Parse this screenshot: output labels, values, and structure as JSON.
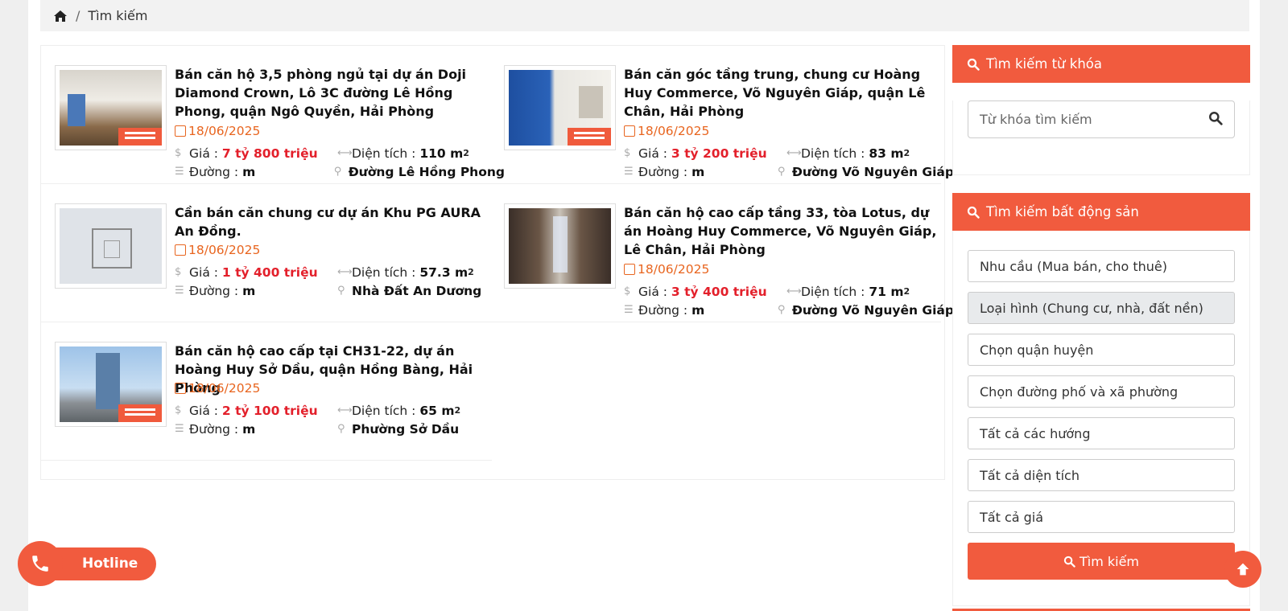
{
  "breadcrumb": {
    "home_icon": "home-icon",
    "current": "Tìm kiếm"
  },
  "listings": [
    {
      "title": "Bán căn hộ 3,5 phòng ngủ tại dự án Doji Diamond Crown, Lô 3C đường Lê Hồng Phong, quận Ngô Quyền, Hải Phòng",
      "date": "18/06/2025",
      "price_label": "Giá :",
      "price": "7 tỷ 800 triệu",
      "area_label": "Diện tích :",
      "area": "110 m",
      "area_sup": "2",
      "road_label": "Đường :",
      "road": "m",
      "location": "Đường Lê Hồng Phong"
    },
    {
      "title": "Bán căn góc tầng trung, chung cư Hoàng Huy Commerce, Võ Nguyên Giáp, quận Lê Chân, Hải Phòng",
      "date": "18/06/2025",
      "price_label": "Giá :",
      "price": "3 tỷ 200 triệu",
      "area_label": "Diện tích :",
      "area": "83 m",
      "area_sup": "2",
      "road_label": "Đường :",
      "road": "m",
      "location": "Đường Võ Nguyên Giáp"
    },
    {
      "title": "Cần bán căn chung cư dự án Khu PG AURA An Đồng.",
      "date": "18/06/2025",
      "price_label": "Giá :",
      "price": "1 tỷ 400 triệu",
      "area_label": "Diện tích :",
      "area": "57.3 m",
      "area_sup": "2",
      "road_label": "Đường :",
      "road": "m",
      "location": "Nhà Đất An Dương"
    },
    {
      "title": "Bán căn hộ cao cấp tầng 33, tòa Lotus, dự án Hoàng Huy Commerce, Võ Nguyên Giáp, Lê Chân, Hải Phòng",
      "date": "18/06/2025",
      "price_label": "Giá :",
      "price": "3 tỷ 400 triệu",
      "area_label": "Diện tích :",
      "area": "71 m",
      "area_sup": "2",
      "road_label": "Đường :",
      "road": "m",
      "location": "Đường Võ Nguyên Giáp"
    },
    {
      "title": "Bán căn hộ cao cấp tại CH31-22, dự án Hoàng Huy Sở Dầu, quận Hồng Bàng, Hải Phòng",
      "date": "18/06/2025",
      "price_label": "Giá :",
      "price": "2 tỷ 100 triệu",
      "area_label": "Diện tích :",
      "area": "65 m",
      "area_sup": "2",
      "road_label": "Đường :",
      "road": "m",
      "location": "Phường Sở Dầu"
    }
  ],
  "sidebar": {
    "keyword_panel": {
      "title": "Tìm kiếm từ khóa",
      "placeholder": "Từ khóa tìm kiếm"
    },
    "filter_panel": {
      "title": "Tìm kiếm bất động sản",
      "need": "Nhu cầu (Mua bán, cho thuê)",
      "type": "Loại hình (Chung cư, nhà, đất nền)",
      "district": "Chọn quận huyện",
      "street": "Chọn đường phố và xã phường",
      "direction": "Tất cả các hướng",
      "area": "Tất cả diện tích",
      "price": "Tất cả giá",
      "submit": "Tìm kiếm"
    }
  },
  "hotline": {
    "label": "Hotline"
  },
  "colors": {
    "accent": "#f15b3e",
    "price": "#e3202b",
    "date": "#e8651f"
  }
}
